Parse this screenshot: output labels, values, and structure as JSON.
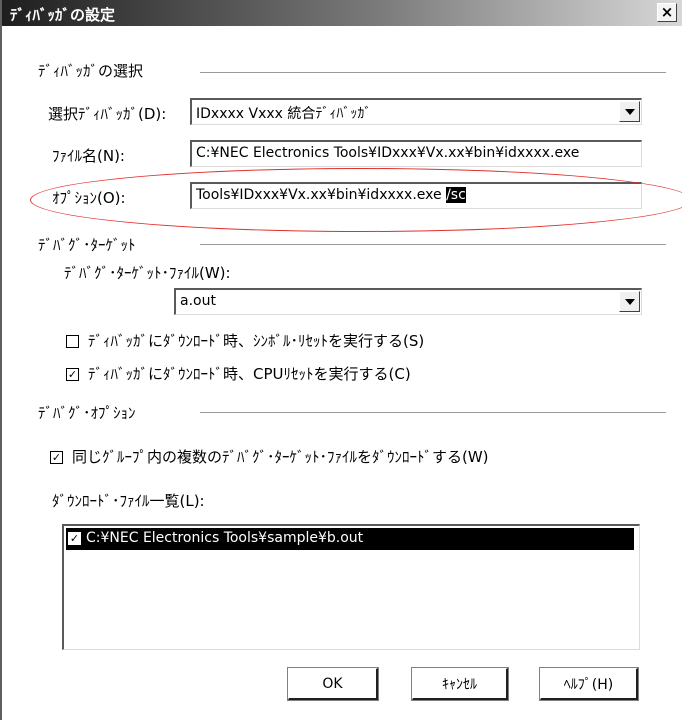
{
  "window": {
    "title": "ﾃﾞｨﾊﾞｯｶﾞの設定",
    "close": "×"
  },
  "debugger_select": {
    "group_label": "ﾃﾞｨﾊﾞｯｶﾞの選択",
    "debugger_label": "選択ﾃﾞｨﾊﾞｯｶﾞ(D):",
    "debugger_value": "IDxxxx Vxxx 統合ﾃﾞｨﾊﾞｯｶﾞ",
    "filename_label": "ﾌｧｲﾙ名(N):",
    "filename_value": "C:¥NEC Electronics Tools¥IDxxx¥Vx.xx¥bin¥idxxxx.exe",
    "option_label": "ｵﾌﾟｼｮﾝ(O):",
    "option_value": "Tools¥IDxxx¥Vx.xx¥bin¥idxxxx.exe",
    "option_selected": "/sc"
  },
  "debug_target": {
    "group_label": "ﾃﾞﾊﾞｸﾞ･ﾀｰｹﾞｯﾄ",
    "file_label": "ﾃﾞﾊﾞｸﾞ･ﾀｰｹﾞｯﾄ･ﾌｧｲﾙ(W):",
    "file_value": "a.out",
    "checkbox1_label": "ﾃﾞｨﾊﾞｯｶﾞにﾀﾞｳﾝﾛｰﾄﾞ時、ｼﾝﾎﾞﾙ･ﾘｾｯﾄを実行する(S)",
    "checkbox1_checked": false,
    "checkbox2_label": "ﾃﾞｨﾊﾞｯｶﾞにﾀﾞｳﾝﾛｰﾄﾞ時、CPUﾘｾｯﾄを実行する(C)",
    "checkbox2_checked": true
  },
  "debug_option": {
    "group_label": "ﾃﾞﾊﾞｸﾞ･ｵﾌﾟｼｮﾝ",
    "checkbox_label": "同じｸﾞﾙｰﾌﾟ内の複数のﾃﾞﾊﾞｸﾞ･ﾀｰｹﾞｯﾄ･ﾌｧｲﾙをﾀﾞｳﾝﾛｰﾄﾞする(W)",
    "checkbox_checked": true,
    "list_label": "ﾀﾞｳﾝﾛｰﾄﾞ･ﾌｧｲﾙ一覧(L):",
    "list_items": [
      {
        "label": "C:¥NEC Electronics Tools¥sample¥b.out",
        "checked": true
      }
    ]
  },
  "buttons": {
    "ok": "OK",
    "cancel": "ｷｬﾝｾﾙ",
    "help": "ﾍﾙﾌﾟ(H)"
  },
  "check_mark": "✓",
  "colors": {
    "highlight_ellipse": "#e0302a",
    "selection": "#000000"
  }
}
